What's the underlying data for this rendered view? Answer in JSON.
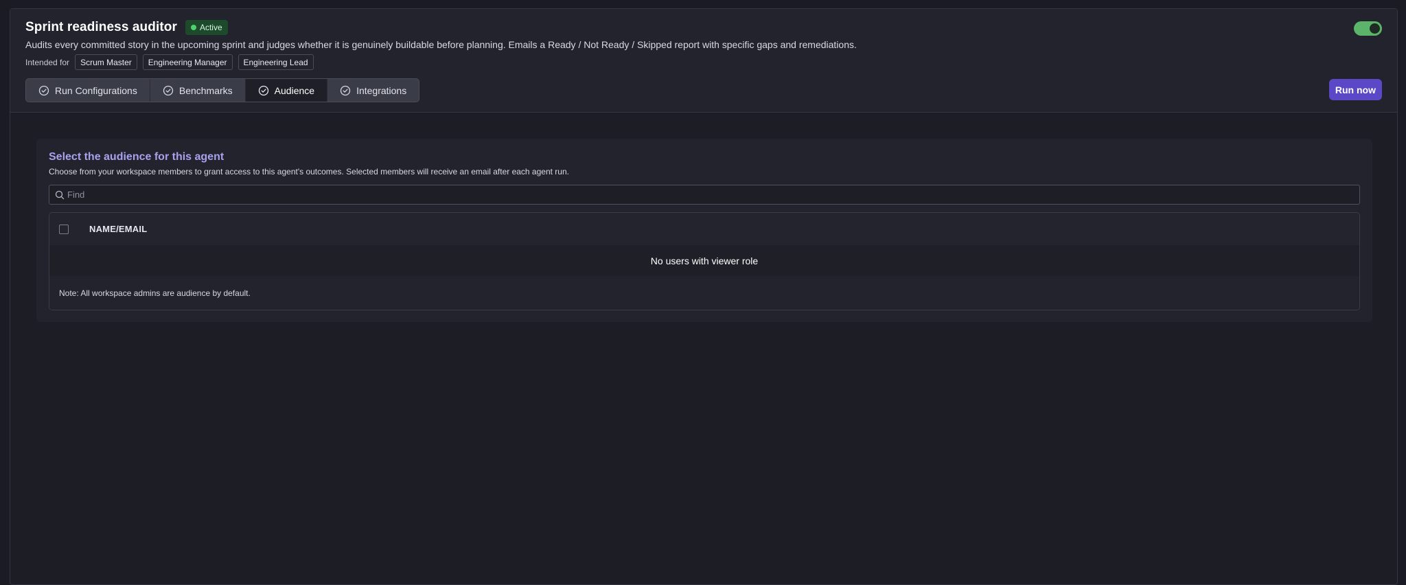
{
  "agent": {
    "title": "Sprint readiness auditor",
    "status": "Active",
    "description": "Audits every committed story in the upcoming sprint and judges whether it is genuinely buildable before planning. Emails a Ready / Not Ready / Skipped report with specific gaps and remediations.",
    "intended_label": "Intended for",
    "intended_for": [
      "Scrum Master",
      "Engineering Manager",
      "Engineering Lead"
    ],
    "enabled": true
  },
  "colors": {
    "accent": "#5b48c7",
    "status_green": "#4fd16e",
    "toggle_on": "#5cb36a",
    "section_title": "#a8a2ee"
  },
  "tabs": [
    {
      "label": "Run Configurations",
      "icon": "check-circle-icon",
      "active": false
    },
    {
      "label": "Benchmarks",
      "icon": "check-circle-icon",
      "active": false
    },
    {
      "label": "Audience",
      "icon": "check-circle-icon",
      "active": true
    },
    {
      "label": "Integrations",
      "icon": "check-circle-icon",
      "active": false
    }
  ],
  "actions": {
    "run_now": "Run now"
  },
  "audience": {
    "title": "Select the audience for this agent",
    "subtitle": "Choose from your workspace members to grant access to this agent's outcomes. Selected members will receive an email after each agent run.",
    "search": {
      "placeholder": "Find",
      "value": ""
    },
    "table": {
      "columns": [
        "NAME/EMAIL"
      ],
      "empty_message": "No users with viewer role",
      "note": "Note: All workspace admins are audience by default."
    }
  }
}
